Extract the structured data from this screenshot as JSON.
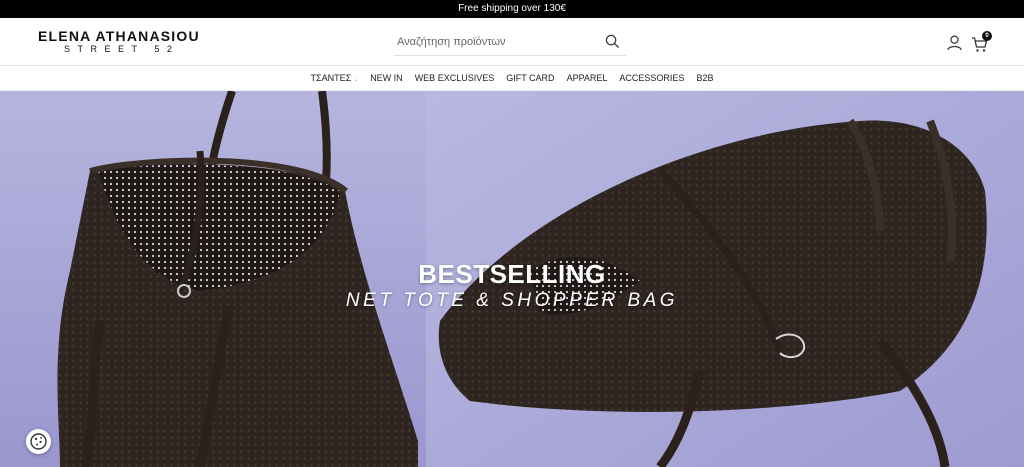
{
  "announcement": {
    "text": "Free shipping over 130€"
  },
  "logo": {
    "line1": "ELENA ATHANASIOU",
    "line2": "STREET 52"
  },
  "search": {
    "placeholder": "Αναζήτηση προϊόντων",
    "icon": "search-icon"
  },
  "header_icons": {
    "account": "user-icon",
    "cart": "cart-icon",
    "cart_count": "0"
  },
  "nav": {
    "items": [
      {
        "label": "ΤΣΑΝΤΕΣ",
        "has_dropdown": true
      },
      {
        "label": "NEW IN"
      },
      {
        "label": "WEB EXCLUSIVES"
      },
      {
        "label": "GIFT CARD"
      },
      {
        "label": "APPAREL"
      },
      {
        "label": "ACCESSORIES"
      },
      {
        "label": "B2B"
      }
    ]
  },
  "hero": {
    "title": "BESTSELLING",
    "subtitle": "NET TOTE & SHOPPER BAG",
    "background_color": "#b1afd9",
    "bag_color": "#2e2420"
  },
  "cookie": {
    "icon": "cookie-icon"
  },
  "colors": {
    "topbar": "#000000",
    "accent": "#111111"
  }
}
